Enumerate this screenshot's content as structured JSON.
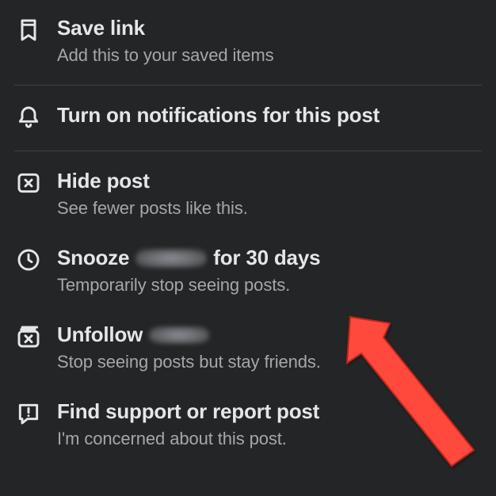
{
  "menu": {
    "items": [
      {
        "title": "Save link",
        "subtitle": "Add this to your saved items"
      },
      {
        "title": "Turn on notifications for this post",
        "subtitle": null
      },
      {
        "title": "Hide post",
        "subtitle": "See fewer posts like this."
      },
      {
        "title_prefix": "Snooze",
        "title_suffix": "for 30 days",
        "subtitle": "Temporarily stop seeing posts."
      },
      {
        "title_prefix": "Unfollow",
        "title_suffix": "",
        "subtitle": "Stop seeing posts but stay friends."
      },
      {
        "title": "Find support or report post",
        "subtitle": "I'm concerned about this post."
      }
    ]
  }
}
